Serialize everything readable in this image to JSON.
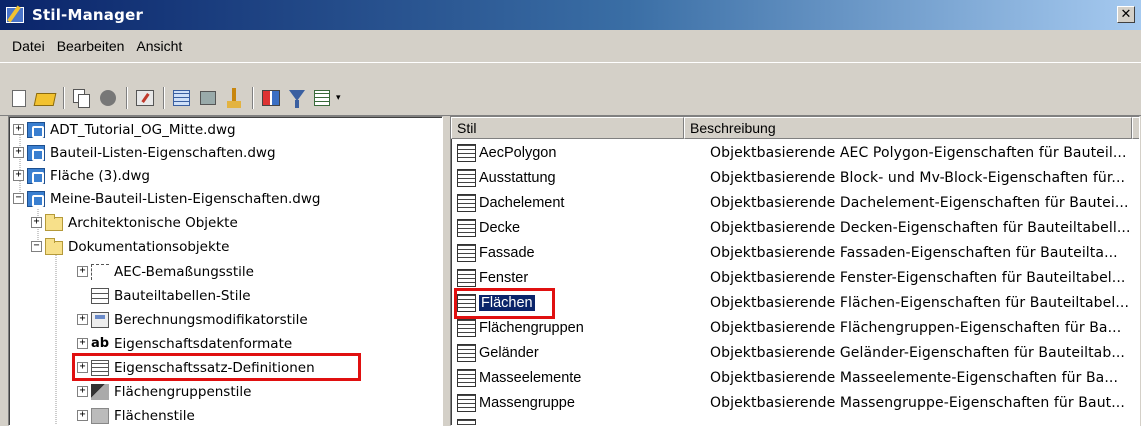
{
  "window": {
    "title": "Stil-Manager",
    "close_glyph": "✕"
  },
  "menu": [
    "Datei",
    "Bearbeiten",
    "Ansicht"
  ],
  "toolbar": {
    "buttons": [
      "new-icon",
      "open-drawing-icon",
      "copy-icon",
      "purge-icon",
      "properties-icon",
      "edit-style-icon",
      "stamp-icon",
      "clean-icon",
      "compare-icon",
      "filter-icon",
      "view-toggle-icon"
    ],
    "dropdown_glyph": "▾"
  },
  "tree": [
    {
      "label": "ADT_Tutorial_OG_Mitte.dwg",
      "expander": "+",
      "icon": "dwg"
    },
    {
      "label": "Bauteil-Listen-Eigenschaften.dwg",
      "expander": "+",
      "icon": "dwg"
    },
    {
      "label": "Fläche (3).dwg",
      "expander": "+",
      "icon": "dwg"
    },
    {
      "label": "Meine-Bauteil-Listen-Eigenschaften.dwg",
      "expander": "−",
      "icon": "dwg"
    },
    {
      "label": "Architektonische Objekte",
      "expander": "+",
      "icon": "folder"
    },
    {
      "label": "Dokumentationsobjekte",
      "expander": "−",
      "icon": "folder"
    },
    {
      "label": "AEC-Bemaßungsstile",
      "expander": "+",
      "icon": "dim"
    },
    {
      "label": "Bauteiltabellen-Stile",
      "expander": "",
      "icon": "table"
    },
    {
      "label": "Berechnungsmodifikatorstile",
      "expander": "+",
      "icon": "calc"
    },
    {
      "label": "Eigenschaftsdatenformate",
      "expander": "+",
      "icon": "ab"
    },
    {
      "label": "Eigenschaftssatz-Definitionen",
      "expander": "+",
      "icon": "propset"
    },
    {
      "label": "Flächengruppenstile",
      "expander": "+",
      "icon": "areagroup"
    },
    {
      "label": "Flächenstile",
      "expander": "+",
      "icon": "area"
    }
  ],
  "ab_glyph": "ab",
  "list": {
    "columns": [
      "Stil",
      "Beschreibung"
    ],
    "rows": [
      {
        "name": "AecPolygon",
        "desc": "Objektbasierende AEC Polygon-Eigenschaften für Bauteil..."
      },
      {
        "name": "Ausstattung",
        "desc": "Objektbasierende Block- und Mv-Block-Eigenschaften für..."
      },
      {
        "name": "Dachelement",
        "desc": "Objektbasierende Dachelement-Eigenschaften für Bautei..."
      },
      {
        "name": "Decke",
        "desc": "Objektbasierende Decken-Eigenschaften für Bauteiltabell..."
      },
      {
        "name": "Fassade",
        "desc": "Objektbasierende Fassaden-Eigenschaften für Bauteilta..."
      },
      {
        "name": "Fenster",
        "desc": "Objektbasierende Fenster-Eigenschaften für Bauteiltabel..."
      },
      {
        "name": "Flächen",
        "desc": "Objektbasierende Flächen-Eigenschaften für Bauteiltabel..."
      },
      {
        "name": "Flächengruppen",
        "desc": "Objektbasierende Flächengruppen-Eigenschaften für Ba..."
      },
      {
        "name": "Geländer",
        "desc": "Objektbasierende Geländer-Eigenschaften für Bauteiltab..."
      },
      {
        "name": "Masseelemente",
        "desc": "Objektbasierende Masseelemente-Eigenschaften für Ba..."
      },
      {
        "name": "Massengruppe",
        "desc": "Objektbasierende Massengruppe-Eigenschaften für Baut..."
      }
    ],
    "selected_index": 6
  },
  "colors": {
    "highlight_box": "#e01010",
    "selection": "#0a246a"
  }
}
